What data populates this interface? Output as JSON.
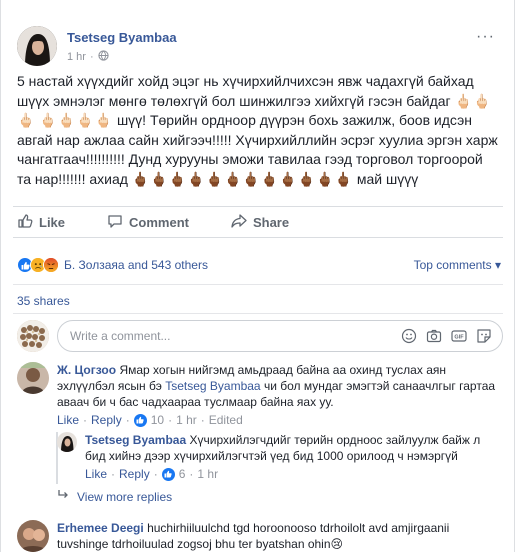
{
  "post": {
    "author": "Tsetseg Byambaa",
    "time": "1 hr",
    "text_main": "5 настай хүүхдийг хойд эцэг нь хүчирхийлчихсэн явж чадахгүй байхад шүүх эмнэлэг мөнгө төлөхгүй бол шинжилгээ хийхгүй гэсэн байдаг",
    "text_cont": "шүү! Төрийн ордноор дүүрэн бохь зажилж, боов идсэн авгай нар ажлаа сайн хийгээч!!!!! Хүчирхийллийн эсрэг хуулиа эргэн харж чангатгаач!!!!!!!!!! Дунд хурууны эможи тавилаа гээд торговол торгоорой та нар!!!!!!! ахиад",
    "text_end": "май шүүү",
    "emoji_a": "🖕🏻🖕🏻🖕🏻",
    "emoji_b": "🖕🏻🖕🏻🖕🏻🖕🏻",
    "emoji_c": "🖕🏾🖕🏾🖕🏾🖕🏾🖕🏾🖕🏾🖕🏾🖕🏾🖕🏾🖕🏾🖕🏾🖕🏾"
  },
  "actions": {
    "like": "Like",
    "comment": "Comment",
    "share": "Share"
  },
  "reactions": {
    "summary": "Б. Золзаяа and 543 others",
    "top_comments": "Top comments"
  },
  "shares": "35 shares",
  "comment_input": {
    "placeholder": "Write a comment..."
  },
  "comments": [
    {
      "author": "Ж. Цогзоо",
      "text_before": "Ямар хогын нийгэмд амьдраад байна аа охинд туслах аян эхлүүлбэл ясын бэ",
      "mention": "Tsetseg Byambaa",
      "text_after": "чи бол мундаг эмэгтэй санаачлгыг гартаа аваач би ч бас чадхаараа туслмаар байна яах уу.",
      "like": "Like",
      "reply": "Reply",
      "like_count": "10",
      "time": "1 hr",
      "edited": "Edited"
    },
    {
      "author": "Tsetseg Byambaa",
      "text": "Хүчирхийлэгчдийг төрийн ордноос зайлуулж байж л бид хийнэ дээр хүчирхийлэгчтэй үед бид 1000 орилоод ч нэмэргүй",
      "like": "Like",
      "reply": "Reply",
      "like_count": "6",
      "time": "1 hr"
    },
    {
      "author": "Erhemee Deegi",
      "text": "huchirhiiluulchd tgd horoonooso tdrhoilolt avd amjirgaanii tuvshinge tdrhoiluulad zogsoj bhu ter byatshan ohin😢"
    }
  ],
  "view_more": "View more replies"
}
